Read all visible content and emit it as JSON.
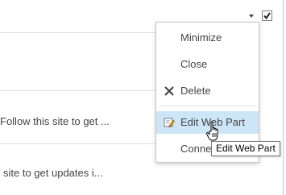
{
  "webpart": {
    "feed_items": [
      "Follow this site to get ...",
      "site to get updates i..."
    ]
  },
  "menu": {
    "items": [
      {
        "label": "Minimize",
        "icon": ""
      },
      {
        "label": "Close",
        "icon": ""
      },
      {
        "label": "Delete",
        "icon": "delete-x-icon"
      },
      {
        "label": "Edit Web Part",
        "icon": "edit-webpart-icon",
        "highlighted": true
      },
      {
        "label": "Connections",
        "icon": ""
      }
    ]
  },
  "tooltip": {
    "text": "Edit Web Part"
  },
  "colors": {
    "highlight": "#cde6f7",
    "text": "#444444",
    "border": "#c6c6c6"
  }
}
